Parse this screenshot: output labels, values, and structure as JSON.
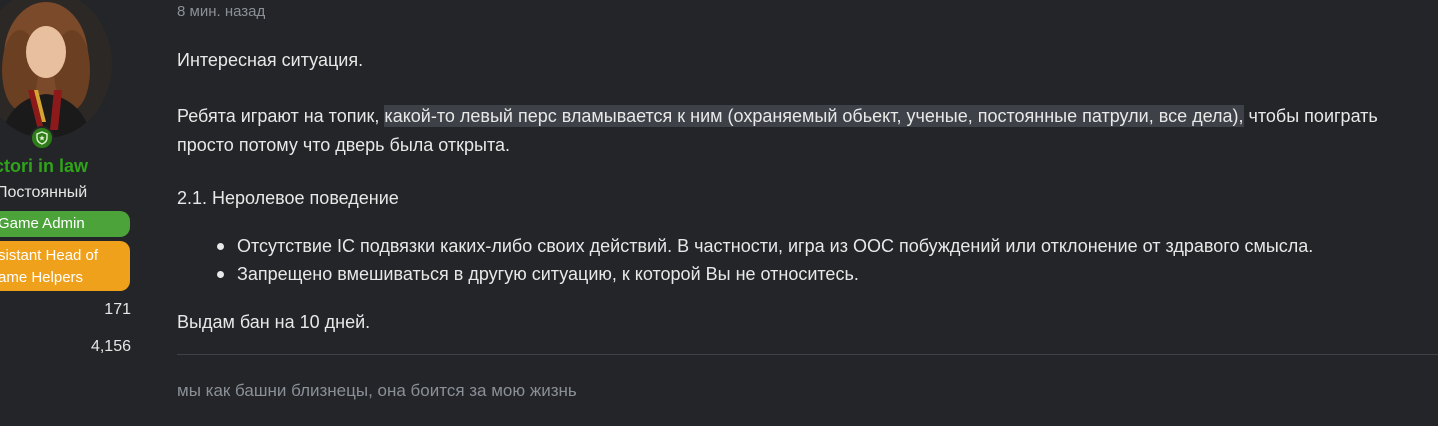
{
  "user": {
    "name": "ctori in law",
    "title": "Постоянный",
    "banners": [
      {
        "label": "Game Admin",
        "color": "#4ba33a"
      },
      {
        "label_line1": "sistant Head of",
        "label_line2": "ame Helpers",
        "color": "#f0a11b"
      }
    ],
    "stats": [
      "171",
      "4,156"
    ],
    "name_color": "#2fa31a",
    "badge_icon": "shield-star-icon"
  },
  "post": {
    "timestamp": "8 мин. назад",
    "paragraph1": "Интересная ситуация.",
    "paragraph2_before": "Ребята играют на топик, ",
    "paragraph2_highlight": "какой-то левый перс вламывается к ним (охраняемый обьект, ученые, постоянные патрули, все дела),",
    "paragraph2_after": " чтобы поиграть",
    "paragraph2_line2": "просто потому что дверь была открыта.",
    "rule_heading": "2.1. Неролевое поведение",
    "rules": [
      "Отсутствие IC подвязки каких-либо своих действий. В частности, игра из OOC побуждений или отклонение от здравого смысла.",
      "Запрещено вмешиваться в другую ситуацию, к которой Вы не относитесь."
    ],
    "verdict": "Выдам бан на 10 дней.",
    "signature": "мы как башни близнецы, она боится за мою жизнь"
  }
}
